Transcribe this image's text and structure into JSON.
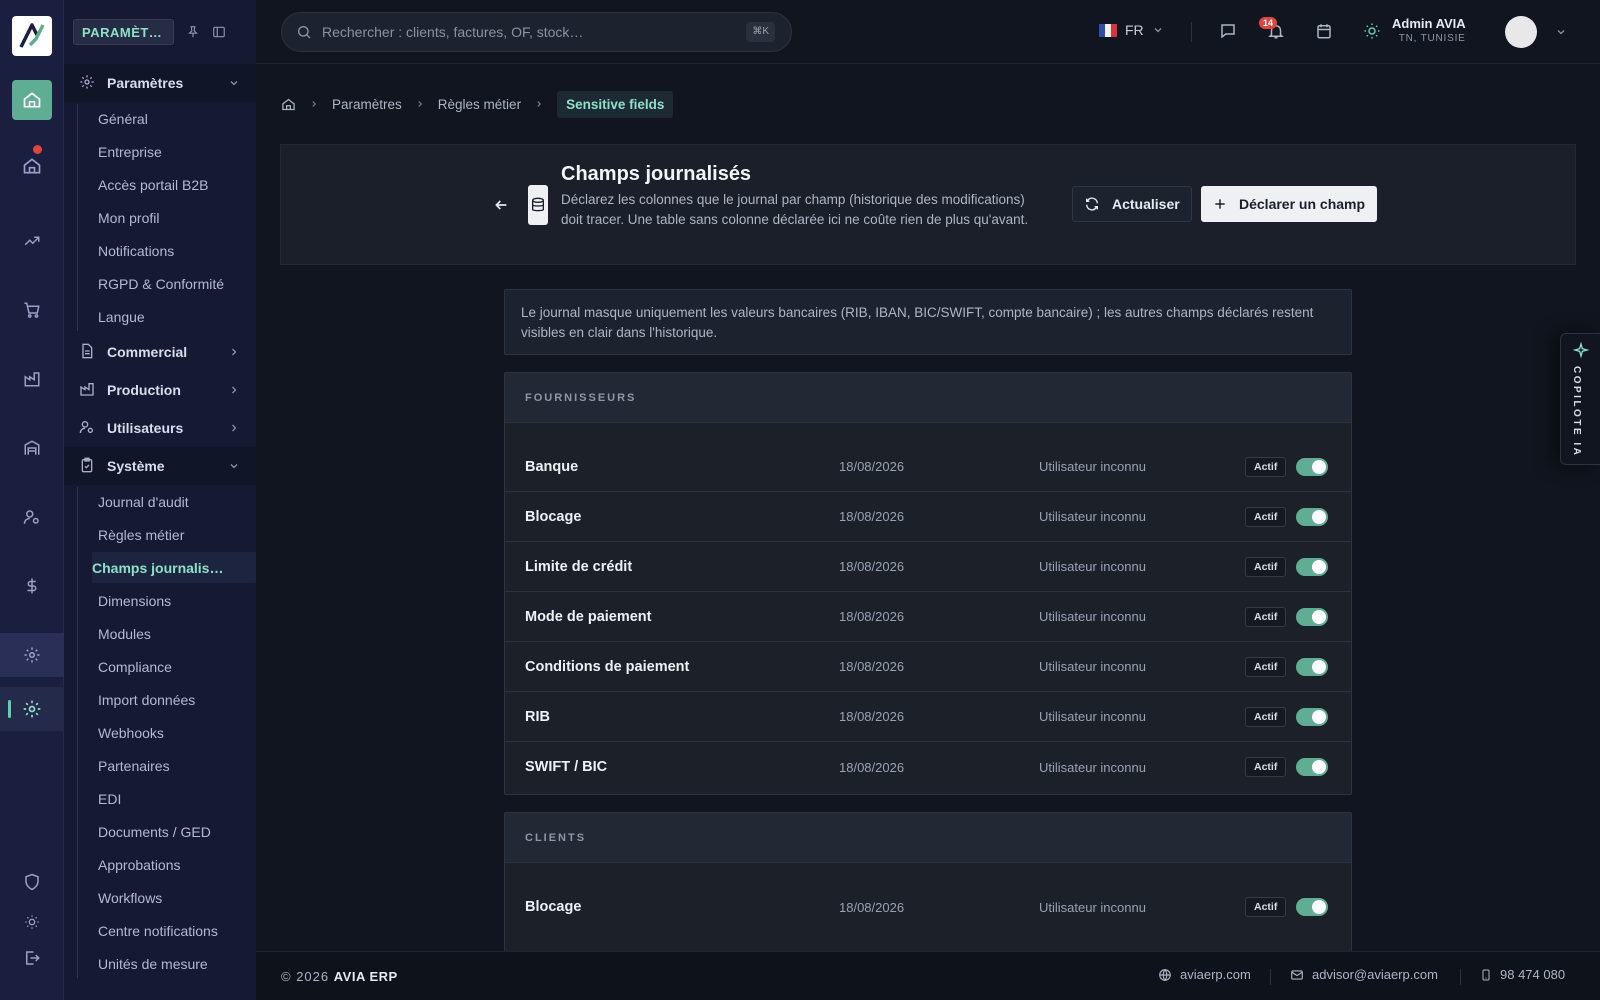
{
  "sidebar": {
    "badge": "PARAMÈT…",
    "groups": [
      {
        "label": "Paramètres"
      },
      {
        "label": "Commercial"
      },
      {
        "label": "Production"
      },
      {
        "label": "Utilisateurs"
      },
      {
        "label": "Système"
      }
    ],
    "params_items": [
      "Général",
      "Entreprise",
      "Accès portail B2B",
      "Mon profil",
      "Notifications",
      "RGPD & Conformité",
      "Langue"
    ],
    "system_items": [
      "Journal d'audit",
      "Règles métier",
      "Champs journalis…",
      "Dimensions",
      "Modules",
      "Compliance",
      "Import données",
      "Webhooks",
      "Partenaires",
      "EDI",
      "Documents / GED",
      "Approbations",
      "Workflows",
      "Centre notifications",
      "Unités de mesure"
    ]
  },
  "topbar": {
    "search_placeholder": "Rechercher : clients, factures, OF, stock…",
    "search_shortcut": "⌘K",
    "lang": "FR",
    "notif_count": "14",
    "user_name": "Admin AVIA",
    "user_location": "TN, TUNISIE"
  },
  "breadcrumb": [
    "Paramètres",
    "Règles métier",
    "Sensitive fields"
  ],
  "header": {
    "title": "Champs journalisés",
    "description": "Déclarez les colonnes que le journal par champ (historique des modifications) doit tracer. Une table sans colonne déclarée ici ne coûte rien de plus qu'avant.",
    "refresh_label": "Actualiser",
    "declare_label": "Déclarer un champ"
  },
  "info": "Le journal masque uniquement les valeurs bancaires (RIB, IBAN, BIC/SWIFT, compte bancaire) ; les autres champs déclarés restent visibles en clair dans l'historique.",
  "sections": [
    {
      "title": "FOURNISSEURS",
      "rows": [
        {
          "name": "Banque",
          "date": "18/08/2026",
          "user": "Utilisateur inconnu",
          "status": "Actif"
        },
        {
          "name": "Blocage",
          "date": "18/08/2026",
          "user": "Utilisateur inconnu",
          "status": "Actif"
        },
        {
          "name": "Limite de crédit",
          "date": "18/08/2026",
          "user": "Utilisateur inconnu",
          "status": "Actif"
        },
        {
          "name": "Mode de paiement",
          "date": "18/08/2026",
          "user": "Utilisateur inconnu",
          "status": "Actif"
        },
        {
          "name": "Conditions de paiement",
          "date": "18/08/2026",
          "user": "Utilisateur inconnu",
          "status": "Actif"
        },
        {
          "name": "RIB",
          "date": "18/08/2026",
          "user": "Utilisateur inconnu",
          "status": "Actif"
        },
        {
          "name": "SWIFT / BIC",
          "date": "18/08/2026",
          "user": "Utilisateur inconnu",
          "status": "Actif"
        }
      ]
    },
    {
      "title": "CLIENTS",
      "rows": [
        {
          "name": "Blocage",
          "date": "18/08/2026",
          "user": "Utilisateur inconnu",
          "status": "Actif"
        }
      ]
    }
  ],
  "copilot_label": "COPILOTE IA",
  "footer": {
    "copyright": "© 2026",
    "brand": "AVIA ERP",
    "website": "aviaerp.com",
    "email": "advisor@aviaerp.com",
    "phone": "98 474 080"
  },
  "colors": {
    "accent": "#5fae93",
    "accent_text": "#8fe0c8",
    "alert": "#e0443c"
  }
}
